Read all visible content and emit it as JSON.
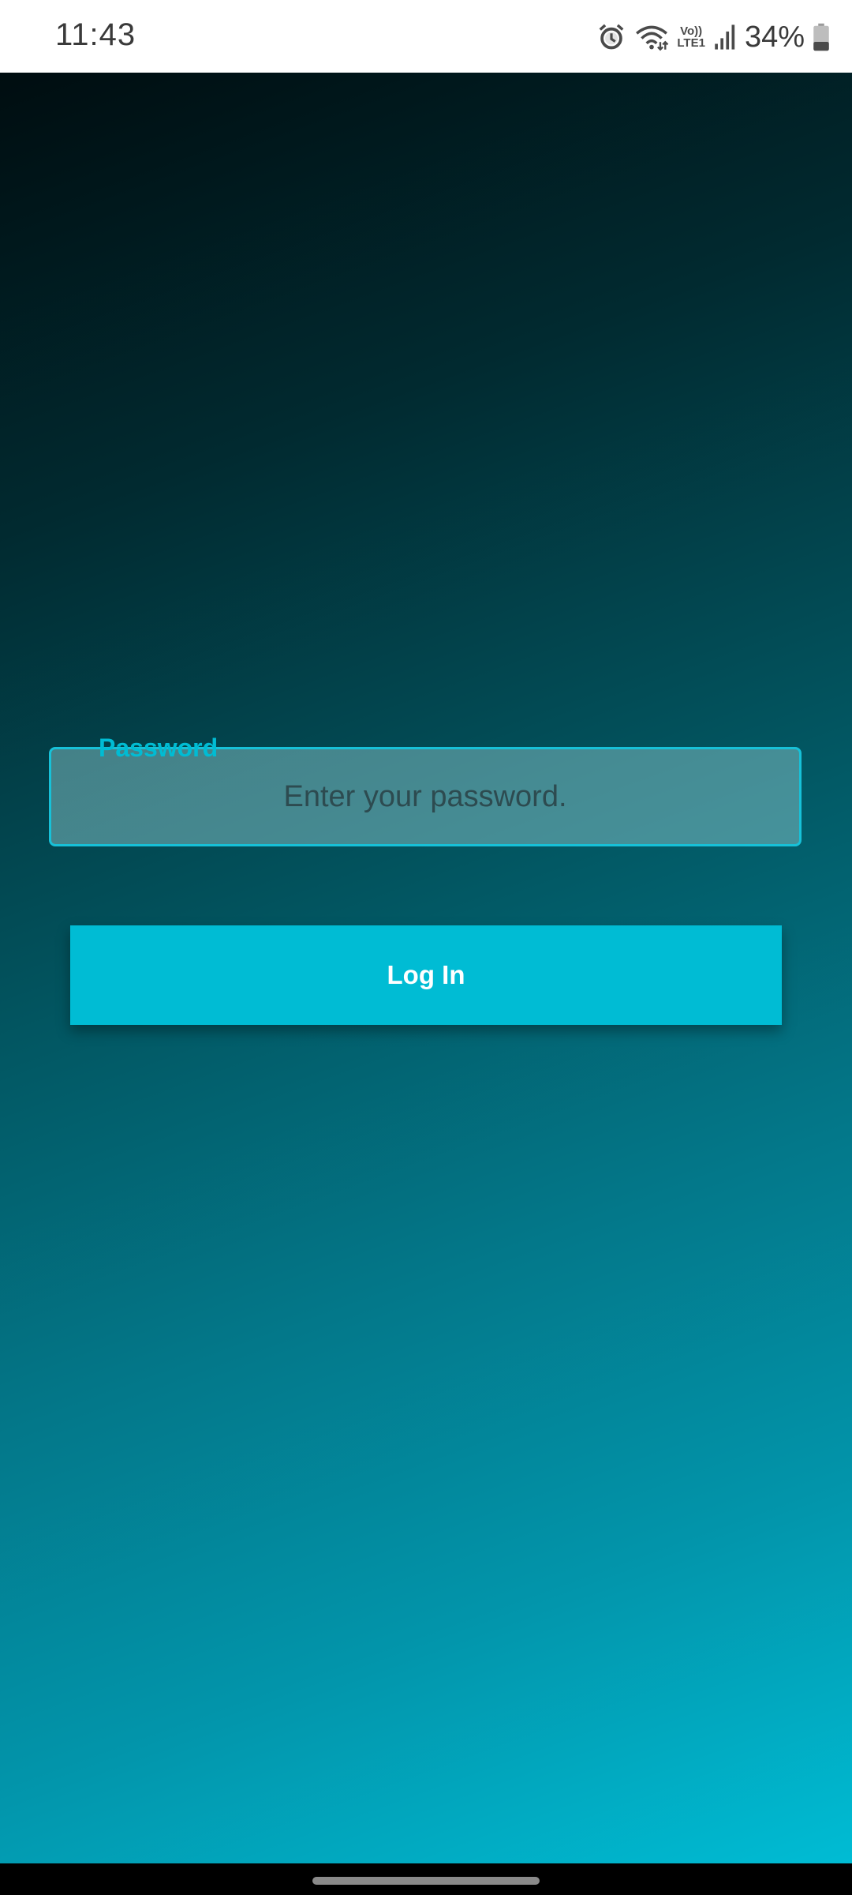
{
  "status_bar": {
    "time": "11:43",
    "volte_top": "Vo))",
    "volte_bottom": "LTE1",
    "battery_percent": "34%",
    "icons": [
      "alarm-icon",
      "wifi-icon",
      "volte-icon",
      "signal-icon",
      "battery-icon"
    ],
    "battery_level": 0.34
  },
  "background": {
    "gradient_start": "#000d10",
    "gradient_end": "#00bcd4"
  },
  "login_form": {
    "password_label": "Password",
    "password_placeholder": "Enter your password.",
    "password_value": "",
    "login_button_label": "Log In",
    "accent_color": "#00bcd4"
  },
  "nav_bar": {
    "home_handle": "home-handle"
  }
}
